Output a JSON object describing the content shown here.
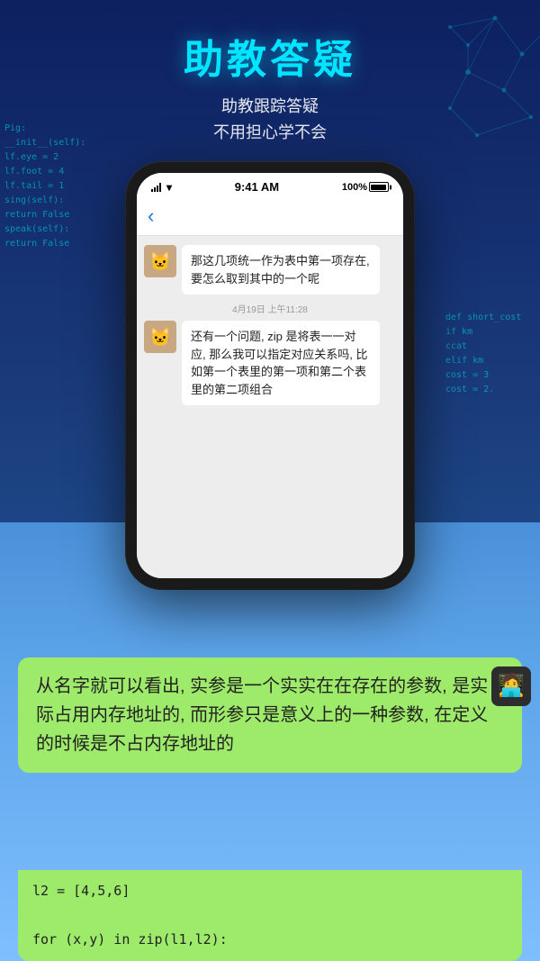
{
  "page": {
    "title": "助教答疑",
    "subtitle_line1": "助教跟踪答疑",
    "subtitle_line2": "不用担心学不会"
  },
  "status_bar": {
    "signal": "●●●●",
    "wifi": "WiFi",
    "time": "9:41 AM",
    "battery": "100%"
  },
  "chat": {
    "back_label": "‹",
    "timestamp": "4月19日 上午11:28",
    "messages": [
      {
        "id": 1,
        "side": "left",
        "avatar": "🐱",
        "text": "那这几项统一作为表中第一项存在, 要怎么取到其中的一个呢"
      },
      {
        "id": 2,
        "side": "left",
        "avatar": "🐱",
        "text": "还有一个问题, zip 是将表一一对应, 那么我可以指定对应关系吗, 比如第一个表里的第一项和第二个表里的第二项组合"
      }
    ]
  },
  "floating_message": {
    "text": "从名字就可以看出, 实参是一个实实在在存在的参数, 是实际占用内存地址的, 而形参只是意义上的一种参数, 在定义的时候是不占内存地址的",
    "avatar": "🧑‍💻"
  },
  "code_snippet": {
    "line1": "l2 = [4,5,6]",
    "line2": "",
    "line3": "for (x,y) in zip(l1,l2):"
  },
  "code_overlay_left": [
    "Pig:",
    "  __init__(self):",
    "  lf.eye = 2",
    "  lf.foot = 4",
    "  lf.tail = 1",
    "  sing(self):",
    "  return False",
    "  speak(self):",
    "  return False"
  ],
  "code_overlay_right": [
    "def short_cost",
    "  if km",
    "    ccat",
    "  elif km",
    "    cost = 3",
    "  cost = 2."
  ]
}
